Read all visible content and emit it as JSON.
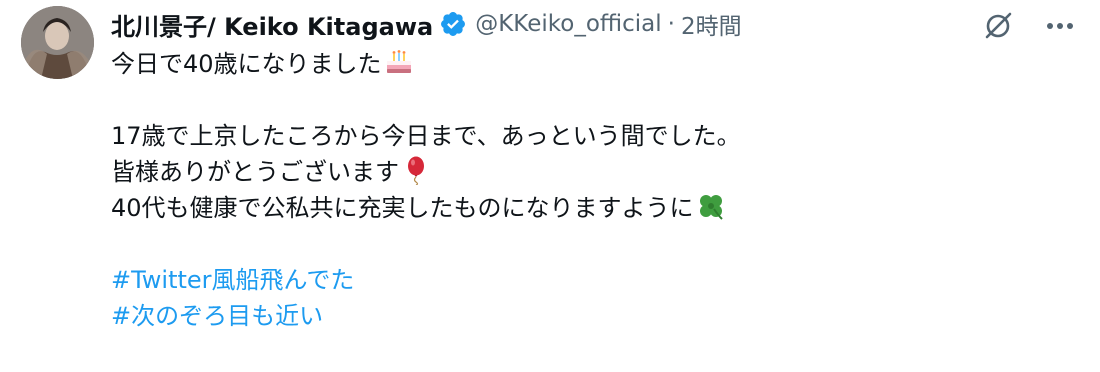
{
  "author": {
    "display_name": "北川景子/ Keiko Kitagawa",
    "handle": "@KKeiko_official",
    "separator": "·",
    "time": "2時間",
    "verified": true
  },
  "icons": {
    "avatar": "profile-photo",
    "verified": "verified-badge-icon",
    "action_1": "grok-icon",
    "action_2": "more-icon"
  },
  "colors": {
    "hashtag": "#1d9bf0",
    "verified": "#1d9bf0",
    "secondary_text": "#536471"
  },
  "tweet": {
    "lines": [
      "今日で40歳になりました",
      "",
      "17歳で上京したころから今日まで、あっという間でした。",
      "皆様ありがとうございます",
      "40代も健康で公私共に充実したものになりますように",
      ""
    ],
    "emojis": [
      "cake",
      "balloon",
      "four-leaf-clover"
    ],
    "hashtags": [
      "#Twitter風船飛んでた",
      "#次のぞろ目も近い"
    ]
  }
}
